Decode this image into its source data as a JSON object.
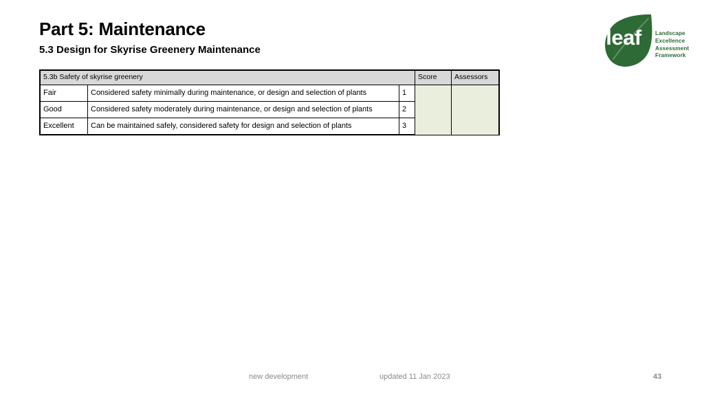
{
  "slide": {
    "title": "Part 5: Maintenance",
    "subtitle": "5.3 Design for Skyrise Greenery Maintenance"
  },
  "logo": {
    "mark_text": "leaf",
    "tagline": [
      "Landscape",
      "Excellence",
      "Assessment",
      "Framework"
    ],
    "green": "#2d6a35"
  },
  "table": {
    "criterion_header": "5.3b Safety of skyrise greenery",
    "score_header": "Score",
    "assessors_header": "Assessors",
    "header_fill": "#d8d8d8",
    "input_fill": "#eaeedd",
    "rows": [
      {
        "rating": "Fair",
        "description": "Considered safety minimally during maintenance, or design and selection of plants",
        "points": "1"
      },
      {
        "rating": "Good",
        "description": "Considered safety moderately during maintenance, or design and selection of plants",
        "points": "2"
      },
      {
        "rating": "Excellent",
        "description": "Can be maintained safely, considered safety for design and selection of plants",
        "points": "3"
      }
    ],
    "score_value": "",
    "assessors_value": ""
  },
  "footer": {
    "left": "new development",
    "center": "updated 11 Jan 2023",
    "page": "43"
  }
}
